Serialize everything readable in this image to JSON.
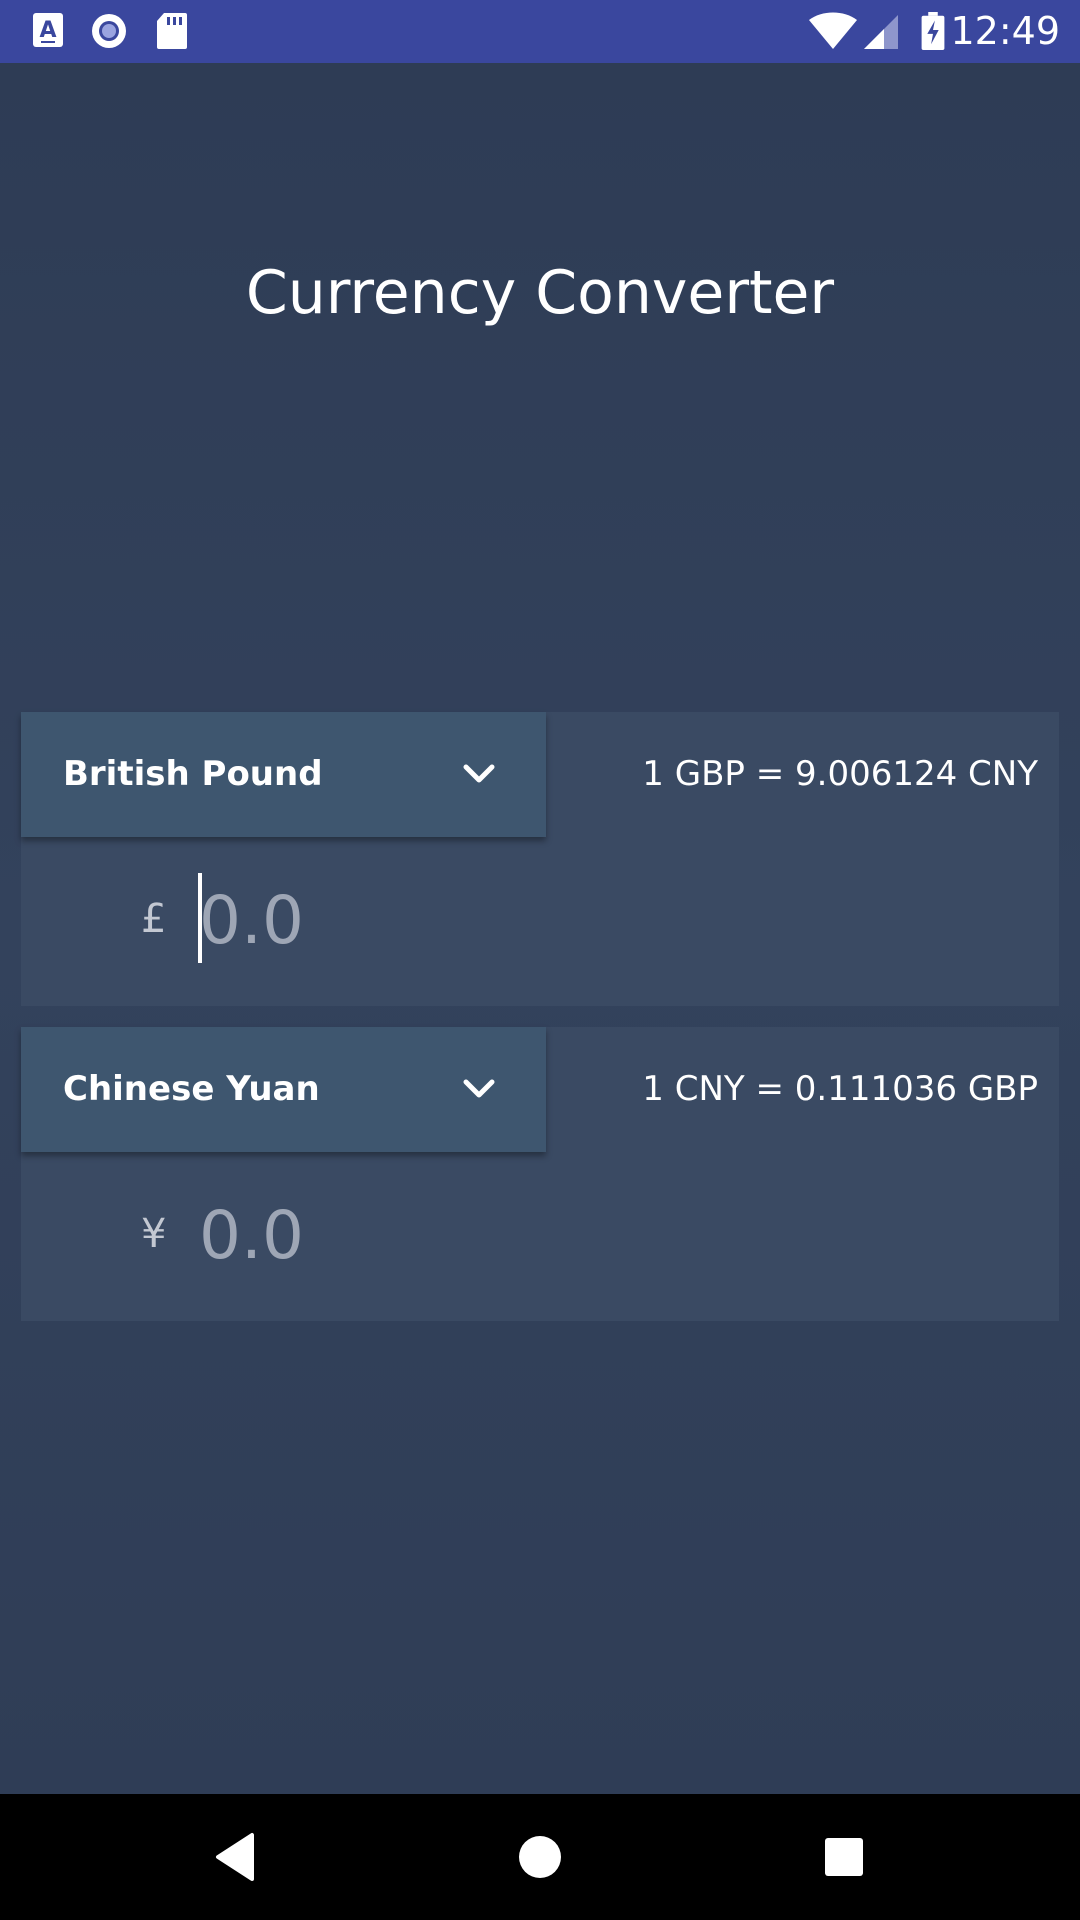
{
  "status_bar": {
    "time": "12:49",
    "icons": [
      "a-notification-icon",
      "record-icon",
      "sd-card-icon",
      "wifi-icon",
      "signal-icon",
      "battery-charging-icon"
    ]
  },
  "app": {
    "title": "Currency Converter"
  },
  "currency_from": {
    "name": "British Pound",
    "rate_text": "1 GBP = 9.006124 CNY",
    "symbol": "£",
    "amount_placeholder": "0.0"
  },
  "currency_to": {
    "name": "Chinese Yuan",
    "rate_text": "1 CNY = 0.111036 GBP",
    "symbol": "¥",
    "amount_placeholder": "0.0"
  },
  "nav_bar": {
    "buttons": [
      "back-icon",
      "home-icon",
      "recents-icon"
    ]
  },
  "colors": {
    "status_bar": "#3a479e",
    "background": "#2f3e56",
    "card": "#3a4a63",
    "select": "#3e566f"
  }
}
